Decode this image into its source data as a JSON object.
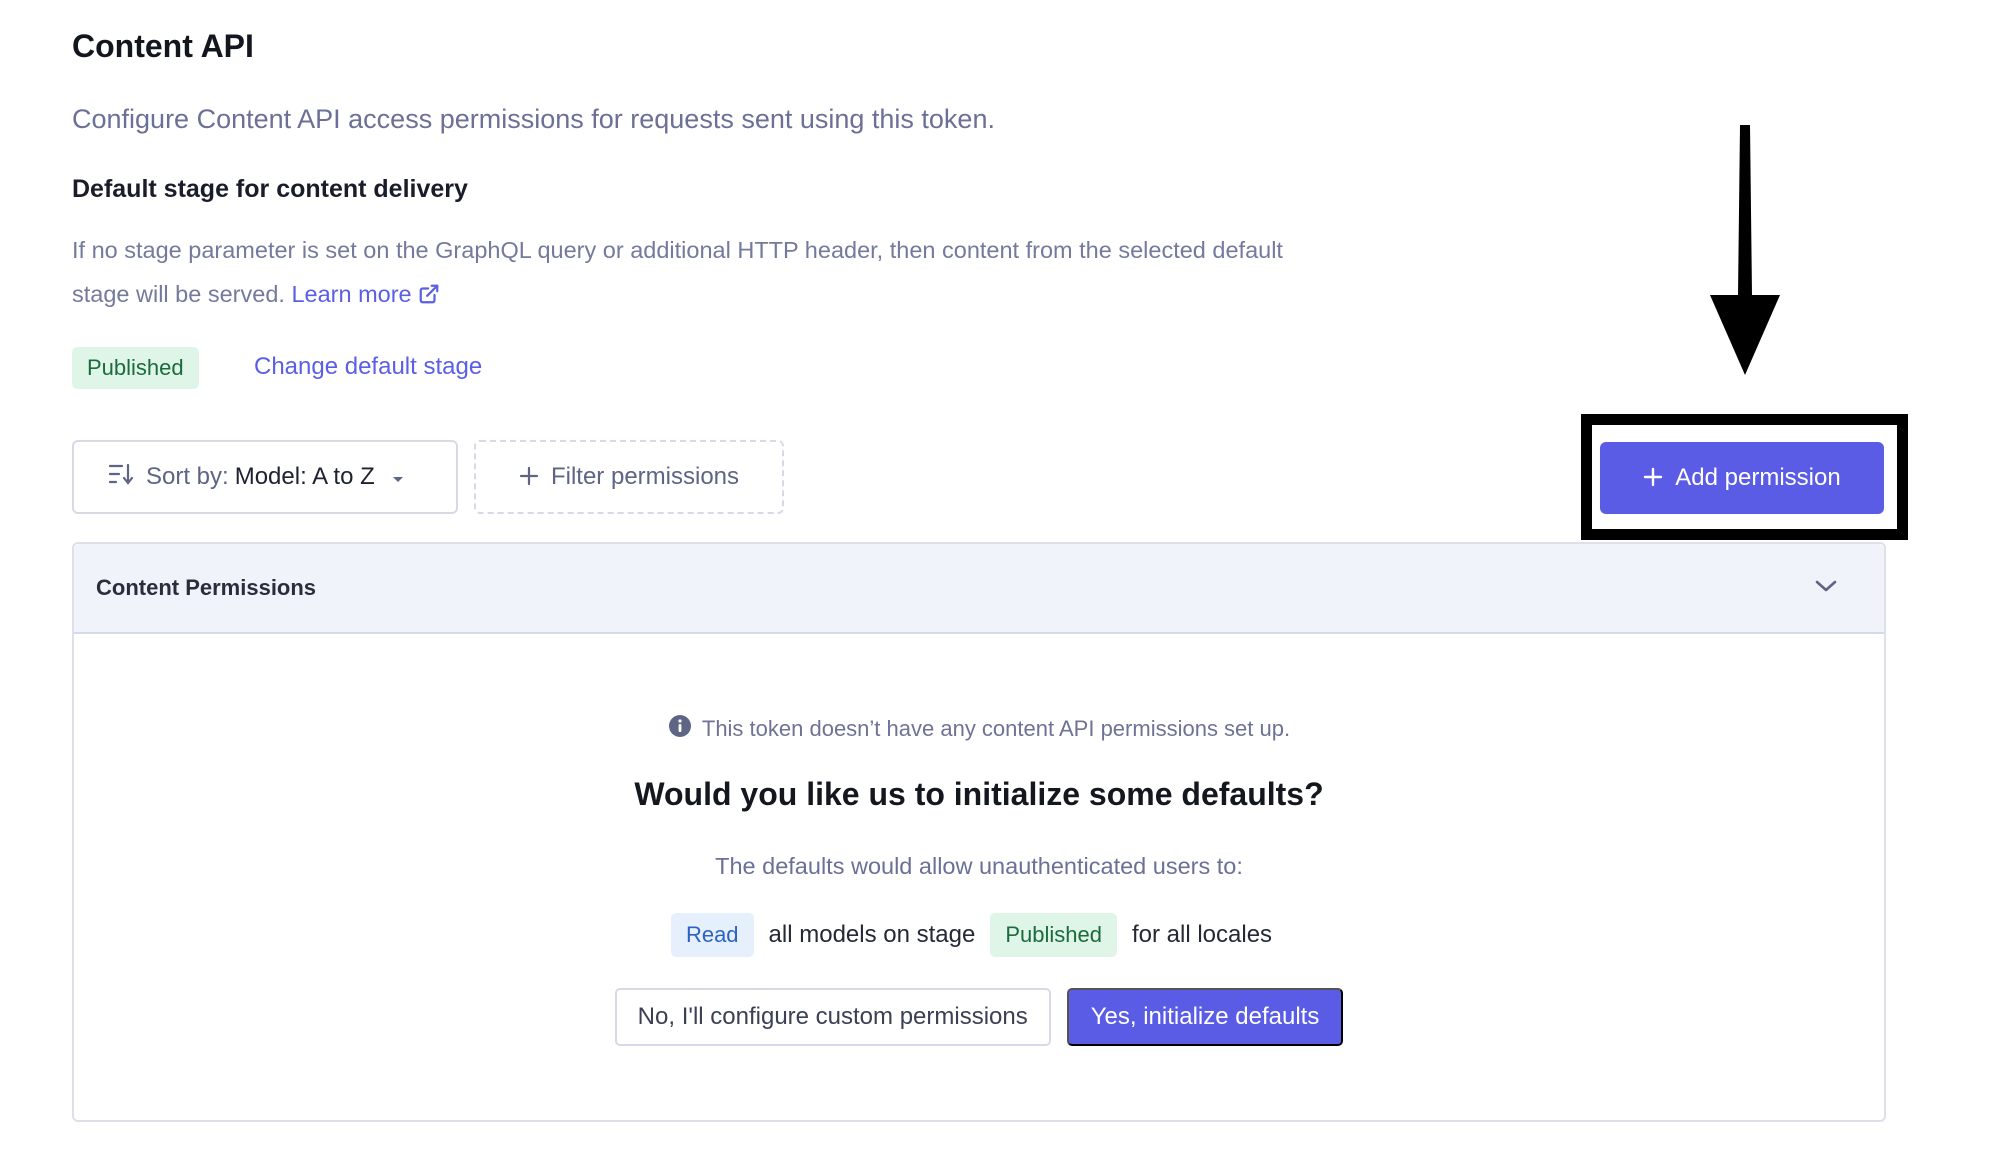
{
  "header": {
    "title": "Content API",
    "subtitle": "Configure Content API access permissions for requests sent using this token."
  },
  "default_stage": {
    "heading": "Default stage for content delivery",
    "help_text": "If no stage parameter is set on the GraphQL query or additional HTTP header, then content from the selected default stage will be served.",
    "learn_more": "Learn more",
    "stage_badge": "Published",
    "change_link": "Change default stage"
  },
  "toolbar": {
    "sort_prefix": "Sort by:",
    "sort_value": "Model: A to Z",
    "filter_label": "Filter permissions",
    "add_label": "Add permission"
  },
  "panel": {
    "header": "Content Permissions",
    "info": "This token doesn’t have any content API permissions set up.",
    "question": "Would you like us to initialize some defaults?",
    "explain": "The defaults would allow unauthenticated users to:",
    "rule": {
      "action": "Read",
      "middle": "all models on stage",
      "stage": "Published",
      "suffix": "for all locales"
    },
    "decline_label": "No, I'll configure custom permissions",
    "accept_label": "Yes, initialize defaults"
  },
  "colors": {
    "primary": "#5b5ce6",
    "link": "#5a5fe5",
    "published_bg": "#dff5e7",
    "published_text": "#1c6b3e",
    "read_bg": "#e6f0fd",
    "read_text": "#2c62c4",
    "annotation": "#000000"
  },
  "icons": [
    "external-link-icon",
    "sort-icon",
    "caret-down-icon",
    "plus-icon",
    "chevron-down-icon",
    "info-icon",
    "down-arrow-annotation"
  ]
}
